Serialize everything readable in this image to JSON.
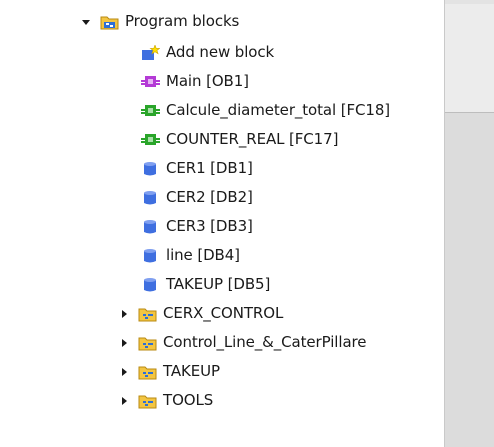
{
  "tree": {
    "program_blocks": {
      "label": "Program blocks"
    },
    "items": [
      {
        "label": "Add new block",
        "icon": "add-new-block-icon"
      },
      {
        "label": "Main [OB1]",
        "icon": "organization-block-icon"
      },
      {
        "label": "Calcule_diameter_total [FC18]",
        "icon": "function-block-icon"
      },
      {
        "label": "COUNTER_REAL [FC17]",
        "icon": "function-block-icon"
      },
      {
        "label": "CER1 [DB1]",
        "icon": "data-block-icon"
      },
      {
        "label": "CER2 [DB2]",
        "icon": "data-block-icon"
      },
      {
        "label": "CER3 [DB3]",
        "icon": "data-block-icon"
      },
      {
        "label": "line [DB4]",
        "icon": "data-block-icon"
      },
      {
        "label": "TAKEUP [DB5]",
        "icon": "data-block-icon"
      }
    ],
    "groups": [
      {
        "label": "CERX_CONTROL",
        "icon": "group-folder-icon"
      },
      {
        "label": "Control_Line_&_CaterPillare",
        "icon": "group-folder-icon"
      },
      {
        "label": "TAKEUP",
        "icon": "group-folder-icon"
      },
      {
        "label": "TOOLS",
        "icon": "group-folder-icon"
      }
    ]
  },
  "colors": {
    "ob_purple": "#b43ad6",
    "fc_green": "#2aa52a",
    "db_blue": "#3f6fe0",
    "folder_yellow": "#f3c542"
  }
}
